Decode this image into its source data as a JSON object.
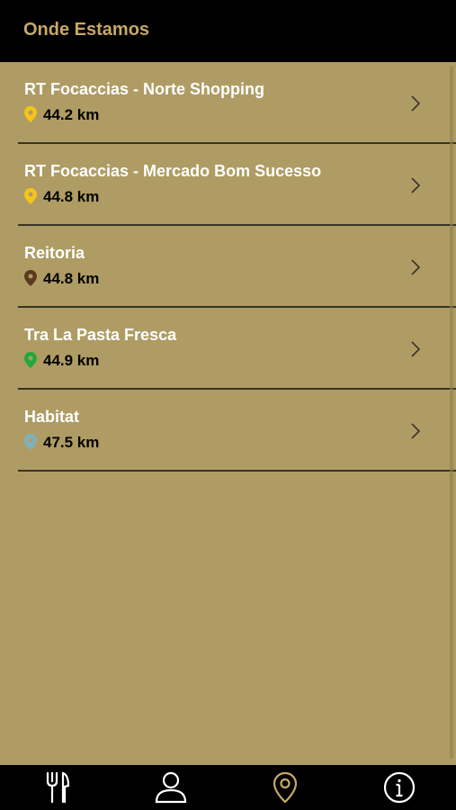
{
  "header": {
    "title": "Onde Estamos"
  },
  "locations": [
    {
      "name": "RT Focaccias - Norte Shopping",
      "distance": "44.2 km",
      "pin_color": "#f5c518"
    },
    {
      "name": "RT Focaccias - Mercado Bom Sucesso",
      "distance": "44.8 km",
      "pin_color": "#f5c518"
    },
    {
      "name": "Reitoria",
      "distance": "44.8 km",
      "pin_color": "#5a3a1e"
    },
    {
      "name": "Tra La Pasta Fresca",
      "distance": "44.9 km",
      "pin_color": "#1faa3a"
    },
    {
      "name": "Habitat",
      "distance": "47.5 km",
      "pin_color": "#7fb0c0"
    }
  ],
  "tabbar": {
    "tabs": [
      {
        "icon": "fork-knife-icon",
        "active": false
      },
      {
        "icon": "user-icon",
        "active": false
      },
      {
        "icon": "map-pin-icon",
        "active": true
      },
      {
        "icon": "info-icon",
        "active": false
      }
    ],
    "active_color": "#c7a867",
    "inactive_color": "#ffffff"
  }
}
